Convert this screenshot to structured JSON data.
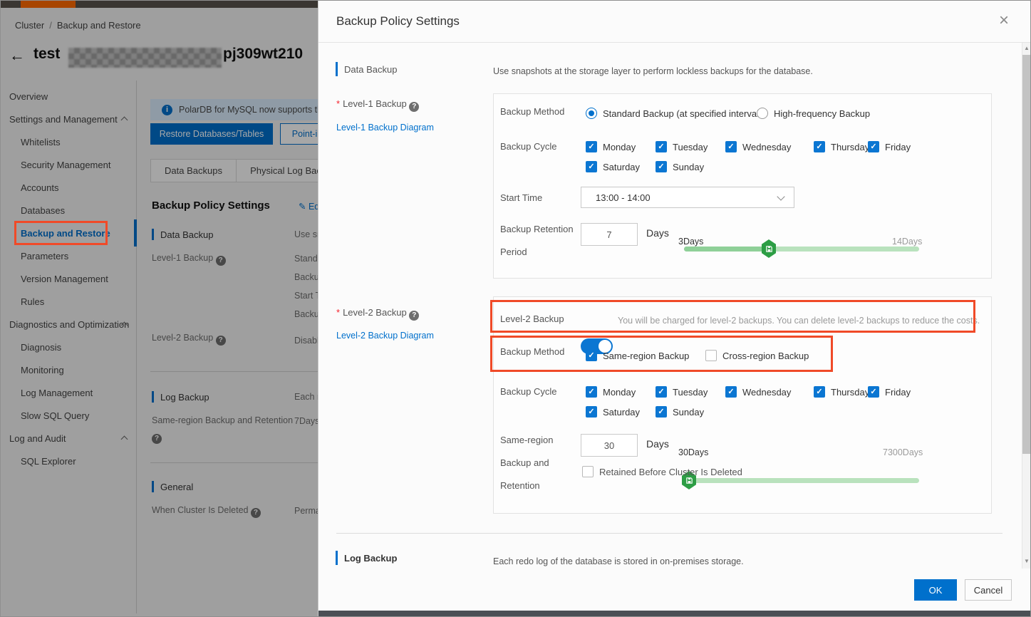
{
  "colors": {
    "accent": "#0070cc",
    "annotation_red": "#f04a28",
    "slider_green": "#2d9e45",
    "brand_orange": "#ff6a00"
  },
  "breadcrumb": {
    "items": [
      "Cluster",
      "Backup and Restore"
    ],
    "separator": "/"
  },
  "cluster_header": {
    "back_glyph": "←",
    "title_prefix": "test",
    "title_suffix": "pj309wt210"
  },
  "sidebar": {
    "items": [
      {
        "label": "Overview"
      },
      {
        "label": "Settings and Management"
      },
      {
        "label": "Whitelists"
      },
      {
        "label": "Security Management"
      },
      {
        "label": "Accounts"
      },
      {
        "label": "Databases"
      },
      {
        "label": "Backup and Restore"
      },
      {
        "label": "Parameters"
      },
      {
        "label": "Version Management"
      },
      {
        "label": "Rules"
      },
      {
        "label": "Diagnostics and Optimization"
      },
      {
        "label": "Diagnosis"
      },
      {
        "label": "Monitoring"
      },
      {
        "label": "Log Management"
      },
      {
        "label": "Slow SQL Query"
      },
      {
        "label": "Log and Audit"
      },
      {
        "label": "SQL Explorer"
      }
    ]
  },
  "background_page": {
    "banner_text": "PolarDB for MySQL now supports th",
    "banner_icon_glyph": "i",
    "restore_button": "Restore Databases/Tables",
    "point_in_button": "Point-in",
    "tabs": [
      "Data Backups",
      "Physical Log Bac"
    ],
    "section_title": "Backup Policy Settings",
    "edit_glyph": "✎",
    "edit_label": "Edit",
    "rows": {
      "data_backup_label": "Data Backup",
      "data_backup_value": "Use sn",
      "level1_label": "Level-1 Backup",
      "level1_value_1": "Standa",
      "level1_value_2": "Backup",
      "level1_value_3": "Start T",
      "level1_value_4": "Backup",
      "level2_label": "Level-2 Backup",
      "level2_value": "Disabl",
      "log_backup_label": "Log Backup",
      "log_backup_value": "Each r",
      "same_region_label": "Same-region Backup and Retention",
      "same_region_value": "7Days",
      "general_label": "General",
      "cluster_deleted_label": "When Cluster Is Deleted",
      "cluster_deleted_value": "Perma"
    }
  },
  "modal": {
    "title": "Backup Policy Settings",
    "close_glyph": "×",
    "nav": {
      "required_mark": "*",
      "data_backup": "Data Backup",
      "level1_label": "Level-1 Backup",
      "level1_link": "Level-1 Backup Diagram",
      "level2_label": "Level-2 Backup",
      "level2_link": "Level-2 Backup Diagram",
      "log_backup": "Log Backup"
    },
    "data_backup_desc": "Use snapshots at the storage layer to perform lockless backups for the database.",
    "level1": {
      "backup_method_label": "Backup Method",
      "method_option_1": "Standard Backup (at specified intervals)",
      "method_option_2": "High-frequency Backup",
      "backup_cycle_label": "Backup Cycle",
      "days": [
        "Monday",
        "Tuesday",
        "Wednesday",
        "Thursday",
        "Friday",
        "Saturday",
        "Sunday"
      ],
      "start_time_label": "Start Time",
      "start_time_value": "13:00 - 14:00",
      "retention_label_line1": "Backup Retention",
      "retention_label_line2": "Period",
      "retention_value": "7",
      "days_unit": "Days",
      "slider_min_label": "3Days",
      "slider_max_label": "14Days"
    },
    "level2": {
      "toggle_label": "Level-2 Backup",
      "toggle_note": "You will be charged for level-2 backups. You can delete level-2 backups to reduce the costs.",
      "backup_method_label": "Backup Method",
      "method_option_1": "Same-region Backup",
      "method_option_2": "Cross-region Backup",
      "backup_cycle_label": "Backup Cycle",
      "days": [
        "Monday",
        "Tuesday",
        "Wednesday",
        "Thursday",
        "Friday",
        "Saturday",
        "Sunday"
      ],
      "retention_label_line1": "Same-region",
      "retention_label_line2": "Backup and",
      "retention_label_line3": "Retention",
      "retention_value": "30",
      "days_unit": "Days",
      "slider_min_label": "30Days",
      "slider_max_label": "7300Days",
      "retained_checkbox_label": "Retained Before Cluster Is Deleted"
    },
    "log_backup": {
      "label": "Log Backup",
      "desc": "Each redo log of the database is stored in on-premises storage."
    },
    "footer": {
      "ok": "OK",
      "cancel": "Cancel"
    },
    "scrollbar": {
      "up_glyph": "▲",
      "down_glyph": "▼"
    }
  }
}
